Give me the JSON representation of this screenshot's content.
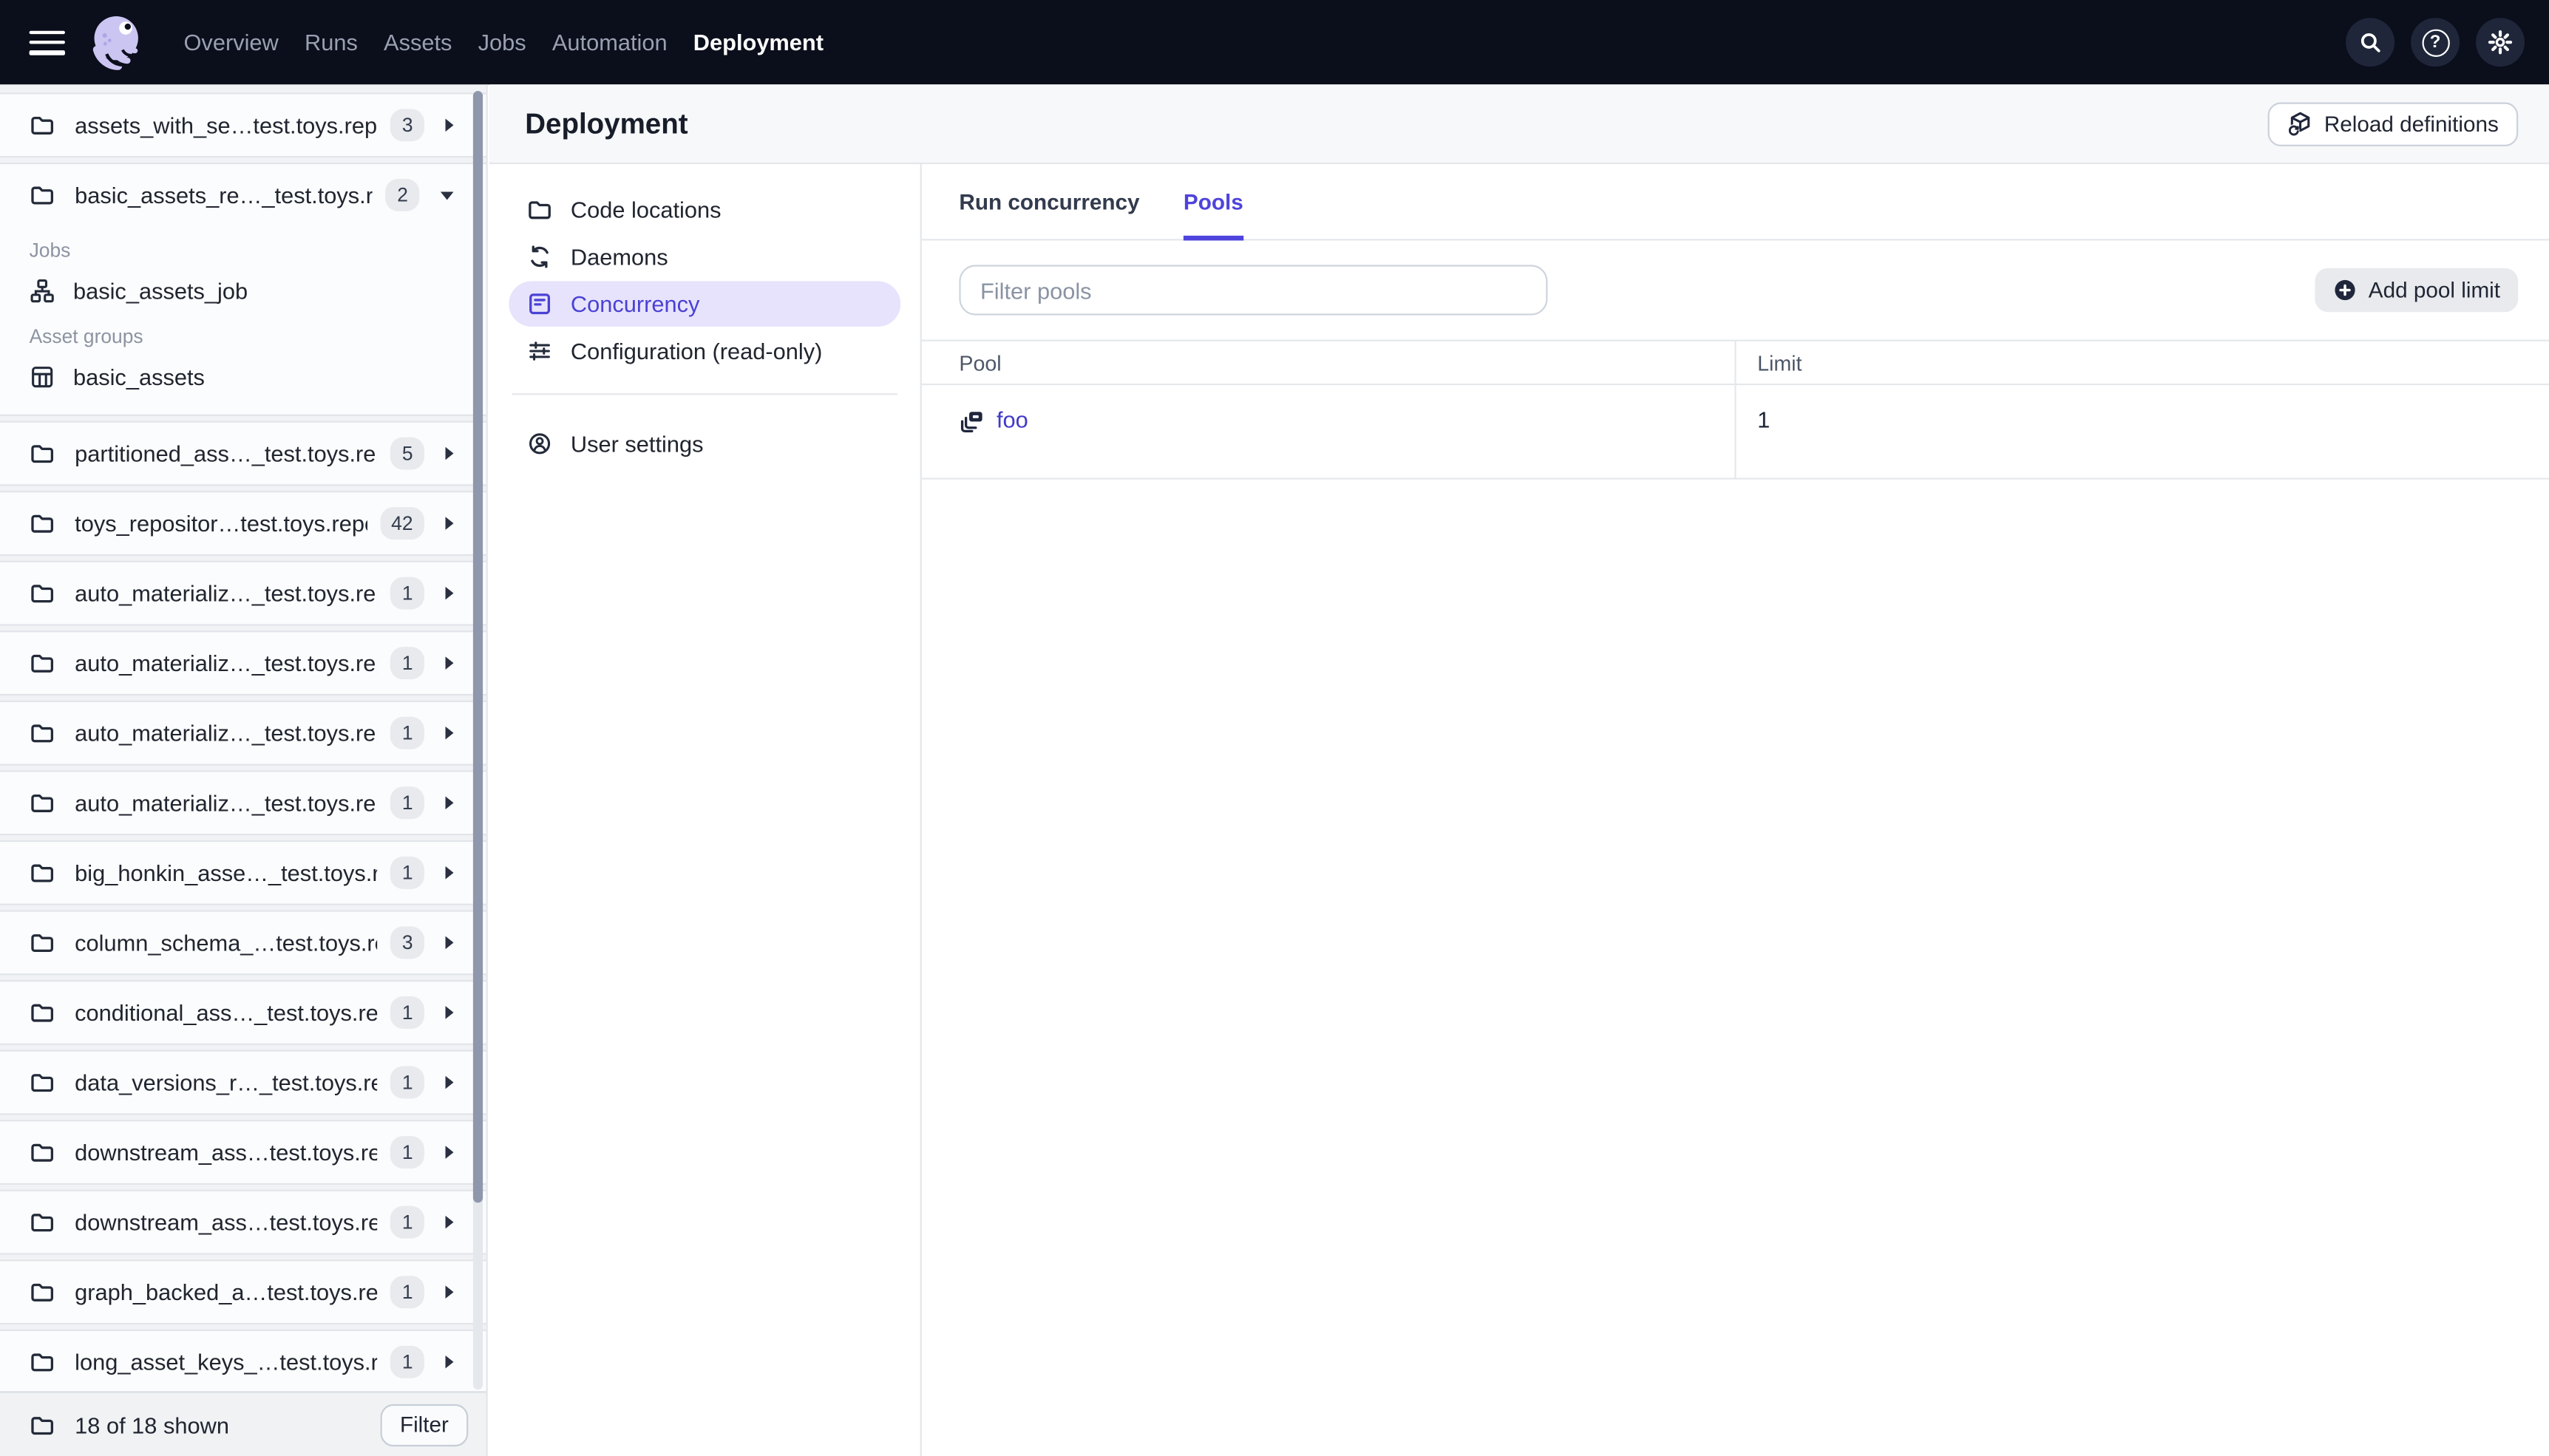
{
  "colors": {
    "accent": "#4F43DD",
    "nav_background": "#0B0E1B",
    "selected_item_background": "#E7E3FC",
    "link": "#4239C8",
    "badge_background": "#E8EAED"
  },
  "icons": {
    "menu": "hamburger",
    "logo": "dagster-octopus",
    "search": "magnifier",
    "help_glyph": "?",
    "settings": "gear",
    "folder": "folder",
    "job": "workflow",
    "asset_group": "grid-table",
    "daemons": "sync-arrows",
    "concurrency": "panel-lines",
    "configuration": "sliders",
    "user": "person-circle",
    "reload": "cube-refresh",
    "add": "plus-circle",
    "pool": "stacked-layers"
  },
  "topnav": {
    "menu_items": [
      "Overview",
      "Runs",
      "Assets",
      "Jobs",
      "Automation"
    ],
    "active_item": "Deployment"
  },
  "sidebar": {
    "top_item": {
      "label": "assets_with_se…test.toys.repo",
      "badge": "3"
    },
    "expanded_item": {
      "label": "basic_assets_re…_test.toys.repo",
      "badge": "2",
      "jobs_heading": "Jobs",
      "jobs": [
        "basic_assets_job"
      ],
      "asset_groups_heading": "Asset groups",
      "asset_groups": [
        "basic_assets"
      ]
    },
    "items": [
      {
        "label": "partitioned_ass…_test.toys.rep",
        "badge": "5"
      },
      {
        "label": "toys_repositor…test.toys.repo",
        "badge": "42"
      },
      {
        "label": "auto_materializ…_test.toys.repo",
        "badge": "1"
      },
      {
        "label": "auto_materializ…_test.toys.repo",
        "badge": "1"
      },
      {
        "label": "auto_materializ…_test.toys.repo",
        "badge": "1"
      },
      {
        "label": "auto_materializ…_test.toys.repo",
        "badge": "1"
      },
      {
        "label": "big_honkin_asse…_test.toys.rep",
        "badge": "1"
      },
      {
        "label": "column_schema_…test.toys.rep",
        "badge": "3"
      },
      {
        "label": "conditional_ass…_test.toys.repo",
        "badge": "1"
      },
      {
        "label": "data_versions_r…_test.toys.rep",
        "badge": "1"
      },
      {
        "label": "downstream_ass…test.toys.rep",
        "badge": "1"
      },
      {
        "label": "downstream_ass…test.toys.rep",
        "badge": "1"
      },
      {
        "label": "graph_backed_a…test.toys.repo",
        "badge": "1"
      },
      {
        "label": "long_asset_keys_…test.toys.rep",
        "badge": "1"
      }
    ],
    "footer": {
      "count_text": "18 of 18 shown",
      "filter_button": "Filter"
    }
  },
  "main": {
    "title": "Deployment",
    "reload_button": "Reload definitions",
    "nav": {
      "items": [
        "Code locations",
        "Daemons",
        "Concurrency",
        "Configuration (read-only)"
      ],
      "active": "Concurrency",
      "user_settings": "User settings"
    },
    "tabs": {
      "items": [
        "Run concurrency",
        "Pools"
      ],
      "active": "Pools"
    },
    "pools": {
      "filter_placeholder": "Filter pools",
      "add_button": "Add pool limit",
      "table": {
        "columns": [
          "Pool",
          "Limit"
        ],
        "rows": [
          {
            "pool": "foo",
            "limit": "1"
          }
        ]
      }
    }
  }
}
